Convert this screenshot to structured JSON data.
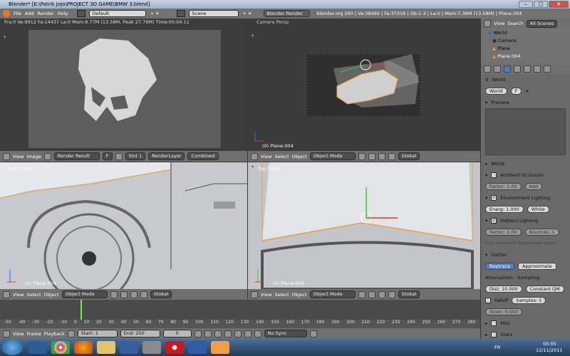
{
  "window": {
    "title": "Blender* [E:\\Patrik Jojo\\PROJECT 3D GAME\\BMW 3.blend]"
  },
  "topbar": {
    "menus": [
      "File",
      "Add",
      "Render",
      "Help"
    ],
    "layout": "Default",
    "scene": "Scene",
    "engine": "Blender Render",
    "stats": "blender.org 260 | Ve:38492 | Fa:37316 | Ob:1-3 | La:0 | Mem:7.36M (13.58M) | Plane.004"
  },
  "image_editor": {
    "render_info": "Fra:0  Ve:9912 Fa:14437 La:0 Mem:9.77M (13.58M, Peak 27.79M) Time:00:04.11",
    "header": {
      "view": "View",
      "image": "Image",
      "result": "Render Result",
      "slot": "Slot 1",
      "layer": "RenderLayer",
      "pass": "Combined"
    }
  },
  "view3d_top": {
    "label": "Camera Persp",
    "object": "(0) Plane.004",
    "header": {
      "view": "View",
      "select": "Select",
      "object": "Object",
      "mode": "Object Mode",
      "orientation": "Global"
    }
  },
  "view_left": {
    "label": "Left Ortho",
    "object": "(0) Plane.004"
  },
  "view_right": {
    "label": "Top Ortho",
    "object": "(0) Plane.004"
  },
  "bottom_header_left": {
    "view": "View",
    "select": "Select",
    "object": "Object",
    "mode": "Object Mode",
    "orientation": "Global"
  },
  "bottom_header_right": {
    "view": "View",
    "select": "Select",
    "object": "Object",
    "mode": "Object Mode",
    "orientation": "Global"
  },
  "outliner": {
    "view": "View",
    "search": "Search",
    "scenes": "All Scenes",
    "items": [
      "World",
      "Camera",
      "Plane",
      "Plane.004"
    ]
  },
  "properties": {
    "breadcrumb": "World",
    "world_name": "World",
    "world_users": "F",
    "preview_label": "Preview",
    "sections": {
      "world": "World",
      "ao": "Ambient Occlusion",
      "ao_factor": "Factor: 1.00",
      "ao_mode": "Add",
      "env": "Environment Lighting",
      "env_energy": "Energ: 1.000",
      "env_color": "White",
      "indirect": "Indirect Lighting",
      "ind_factor": "Factor: 1.00",
      "ind_bounces": "Bounces: 1",
      "ind_note": "Only works with Approximate gather",
      "gather": "Gather",
      "raytrace": "Raytrace",
      "approximate": "Approximate",
      "attenuation": "Attenuation:",
      "sampling": "Sampling:",
      "dist": "Dist: 10.000",
      "const": "Constant QM",
      "falloff": "Falloff",
      "samples": "Samples: 5",
      "strength": "Stren: 0.000",
      "mist": "Mist",
      "stars": "Stars"
    }
  },
  "timeline": {
    "ticks": [
      "-50",
      "-40",
      "-30",
      "-20",
      "-10",
      "0",
      "10",
      "20",
      "30",
      "40",
      "50",
      "60",
      "70",
      "80",
      "90",
      "100",
      "110",
      "120",
      "130",
      "140",
      "150",
      "160",
      "170",
      "180",
      "190",
      "200",
      "210",
      "220",
      "230",
      "240",
      "250",
      "260",
      "270",
      "280"
    ],
    "view": "View",
    "frame": "Frame",
    "playback": "Playback",
    "start": "Start: 1",
    "end": "End: 250",
    "current": "0",
    "sync": "No Sync"
  },
  "taskbar": {
    "lang": "FR",
    "time": "00:05",
    "date": "12/11/2011"
  }
}
